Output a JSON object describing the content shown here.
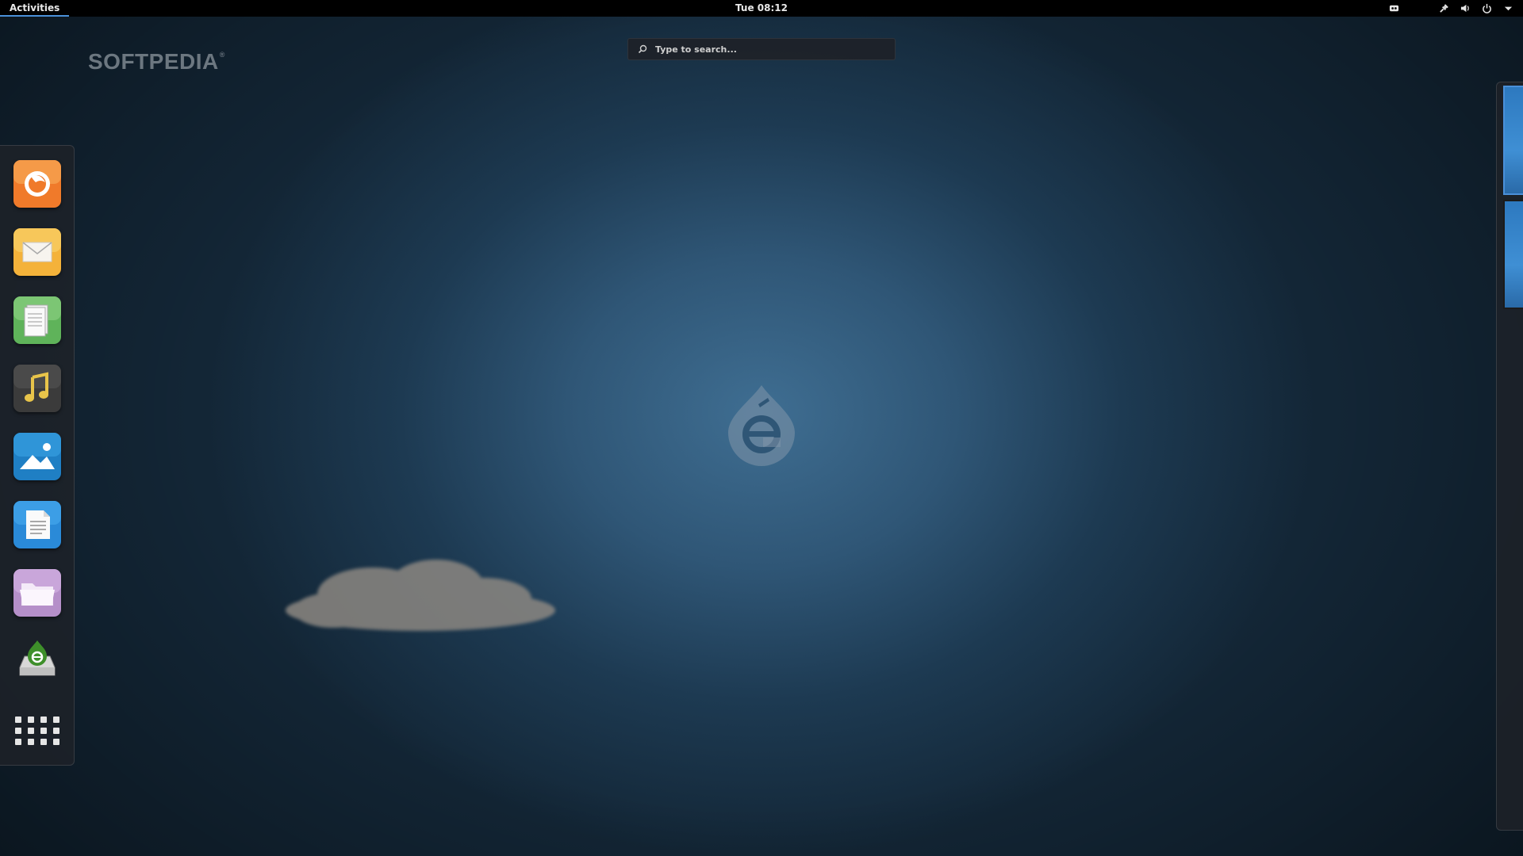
{
  "topbar": {
    "activities_label": "Activities",
    "clock": "Tue 08:12",
    "tray_icons": [
      "accessibility-icon",
      "network-wired-icon",
      "volume-icon",
      "power-icon",
      "chevron-down-icon"
    ]
  },
  "watermark": {
    "text": "SOFTPEDIA",
    "mark": "®"
  },
  "search": {
    "placeholder": "Type to search..."
  },
  "dash": {
    "apps": [
      {
        "name": "firefox-icon",
        "color": "#f07a2a"
      },
      {
        "name": "mail-icon",
        "color": "#f4b23a"
      },
      {
        "name": "notes-icon",
        "color": "#5fb35a"
      },
      {
        "name": "music-icon",
        "color": "#3b3b3b"
      },
      {
        "name": "photos-icon",
        "color": "#1f7fc4"
      },
      {
        "name": "writer-icon",
        "color": "#2a8ad8"
      },
      {
        "name": "files-icon",
        "color": "#b58fc9"
      },
      {
        "name": "installer-icon",
        "color": "#d8d8d8"
      }
    ],
    "show_apps_icon": "app-grid-icon"
  },
  "workspaces": [
    {
      "active": true
    },
    {
      "active": false
    }
  ]
}
